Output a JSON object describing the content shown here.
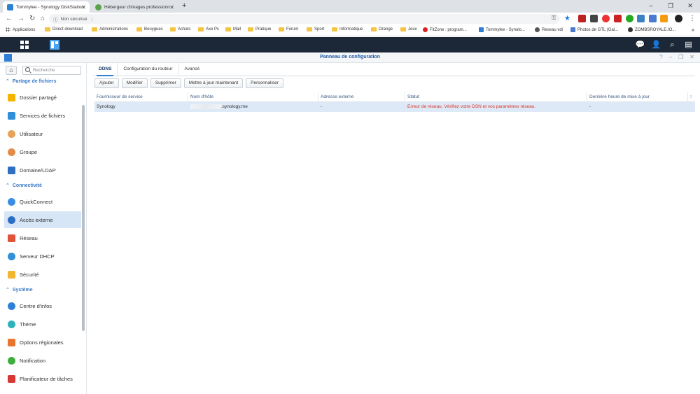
{
  "browser": {
    "tabs": [
      {
        "title": "Tommylee - Synology DiskStation"
      },
      {
        "title": "Hébergeur d'images professionn"
      }
    ],
    "address_security": "Non sécurisé",
    "address_url": "",
    "bookmarks": [
      "Applications",
      "Direct download",
      "Administrations",
      "Bouygues",
      "Achats",
      "Axe Pc",
      "Mail",
      "Pratique",
      "Forum",
      "Sport",
      "Informatique",
      "Orange",
      "Jeux",
      "FitZone : program...",
      "Tommylee - Synolo...",
      "Reseau vdi",
      "Photos de GTL (Gal...",
      "ZOMBSROYALE.IO..."
    ]
  },
  "window": {
    "title": "Panneau de configuration"
  },
  "sidebar": {
    "search_placeholder": "Recherche",
    "sections": [
      {
        "title": "Partage de fichiers",
        "items": [
          "Dossier partagé",
          "Services de fichiers",
          "Utilisateur",
          "Groupe",
          "Domaine/LDAP"
        ]
      },
      {
        "title": "Connectivité",
        "items": [
          "QuickConnect",
          "Accès externe",
          "Réseau",
          "Serveur DHCP",
          "Sécurité"
        ]
      },
      {
        "title": "Système",
        "items": [
          "Centre d'infos",
          "Thème",
          "Options régionales",
          "Notification",
          "Planificateur de tâches"
        ]
      }
    ],
    "selected": "Accès externe"
  },
  "content": {
    "tabs": [
      "DDNS",
      "Configuration du routeur",
      "Avancé"
    ],
    "active_tab": "DDNS",
    "buttons": [
      "Ajouter",
      "Modifier",
      "Supprimer",
      "Mettre à jour maintenant",
      "Personnaliser"
    ],
    "columns": [
      "Fournisseur de service",
      "Nom d'hôte",
      "Adresse externe",
      "Statut",
      "Dernière heure de mise à jour"
    ],
    "rows": [
      {
        "provider": "Synology",
        "hostname": ".synology.me",
        "external_address": "-",
        "status": "Erreur de réseau. Vérifiez votre DSN et vos paramètres réseau.",
        "last_update": "-"
      }
    ]
  },
  "colors": {
    "accent": "#2f7fd7",
    "taskbar": "#1c2838",
    "error": "#d9342b",
    "selected_row": "#dde9f6"
  }
}
